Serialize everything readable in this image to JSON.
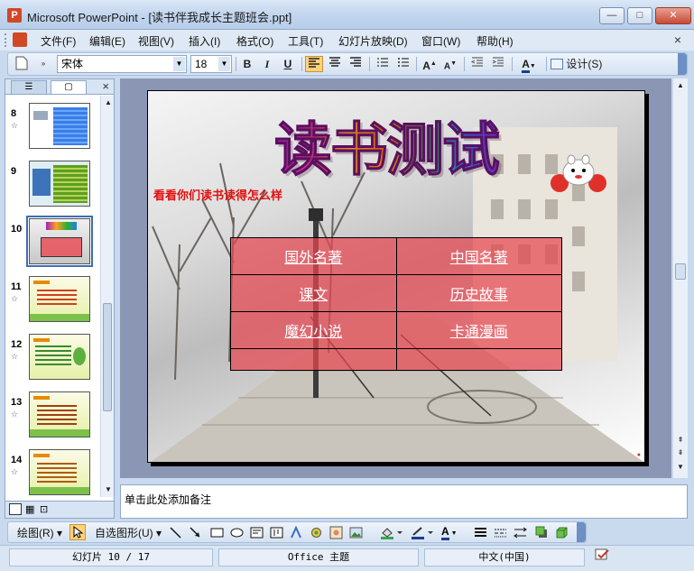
{
  "window": {
    "title": "Microsoft PowerPoint - [读书伴我成长主题班会.ppt]",
    "btn_min": "—",
    "btn_max": "□",
    "btn_close": "✕"
  },
  "menu": {
    "items": [
      "文件(F)",
      "编辑(E)",
      "视图(V)",
      "插入(I)",
      "格式(O)",
      "工具(T)",
      "幻灯片放映(D)",
      "窗口(W)",
      "帮助(H)"
    ],
    "close": "×"
  },
  "toolbar": {
    "font_name": "宋体",
    "font_size": "18",
    "bold": "B",
    "italic": "I",
    "underline": "U",
    "design_label": "设计(S)"
  },
  "slides_panel": {
    "close": "×",
    "slides": [
      {
        "number": "8"
      },
      {
        "number": "9"
      },
      {
        "number": "10"
      },
      {
        "number": "11"
      },
      {
        "number": "12"
      },
      {
        "number": "13"
      },
      {
        "number": "14"
      }
    ],
    "selected_number": "10"
  },
  "slide": {
    "title": "读书测试",
    "subtitle": "看看你们读书读得怎么样",
    "table": [
      [
        "国外名著",
        "中国名著"
      ],
      [
        "课文",
        "历史故事"
      ],
      [
        "魔幻小说",
        "卡通漫画"
      ],
      [
        "",
        ""
      ]
    ]
  },
  "notes": {
    "placeholder": "单击此处添加备注"
  },
  "draw_toolbar": {
    "draw_label": "绘图(R)",
    "autoshapes_label": "自选图形(U)"
  },
  "status": {
    "slide_info": "幻灯片 10 / 17",
    "theme": "Office 主题",
    "language": "中文(中国)"
  },
  "colors": {
    "table_fill": "#e84650",
    "subtitle": "#e01010",
    "accent": "#3b6fb6"
  }
}
